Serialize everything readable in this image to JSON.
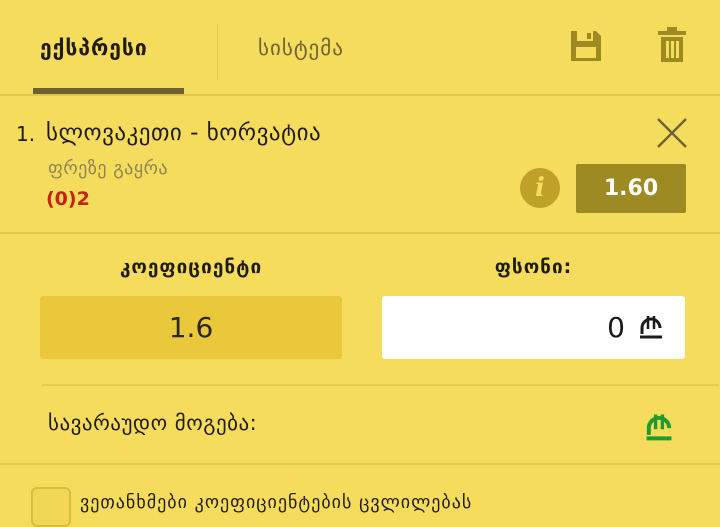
{
  "tabs": [
    {
      "label": "ექსპრესი",
      "active": true
    },
    {
      "label": "სისტემა",
      "active": false
    }
  ],
  "header_icons": {
    "save": "save-icon",
    "delete": "trash-icon"
  },
  "bet": {
    "number": "1.",
    "event": "სლოვაკეთი - ხორვატია",
    "market": "ფრეზე გაყრა",
    "score": "(0)2",
    "odds": "1.60",
    "info_icon": "i"
  },
  "coefficient": {
    "label": "კოეფიციენტი",
    "value": "1.6"
  },
  "stake": {
    "label": "ფსონი:",
    "value": "0",
    "currency": "₾"
  },
  "potential_win": {
    "label": "სავარაუდო მოგება:",
    "currency": "₾"
  },
  "accept_changes": {
    "label": "ვეთანხმები კოეფიციენტების ცვლილებას",
    "checked": false
  },
  "colors": {
    "background": "#f6dc5c",
    "accent_dark": "#6b6230",
    "odds_badge": "#9e8a22",
    "score_red": "#c2250f",
    "currency_green": "#1f9a2e"
  }
}
